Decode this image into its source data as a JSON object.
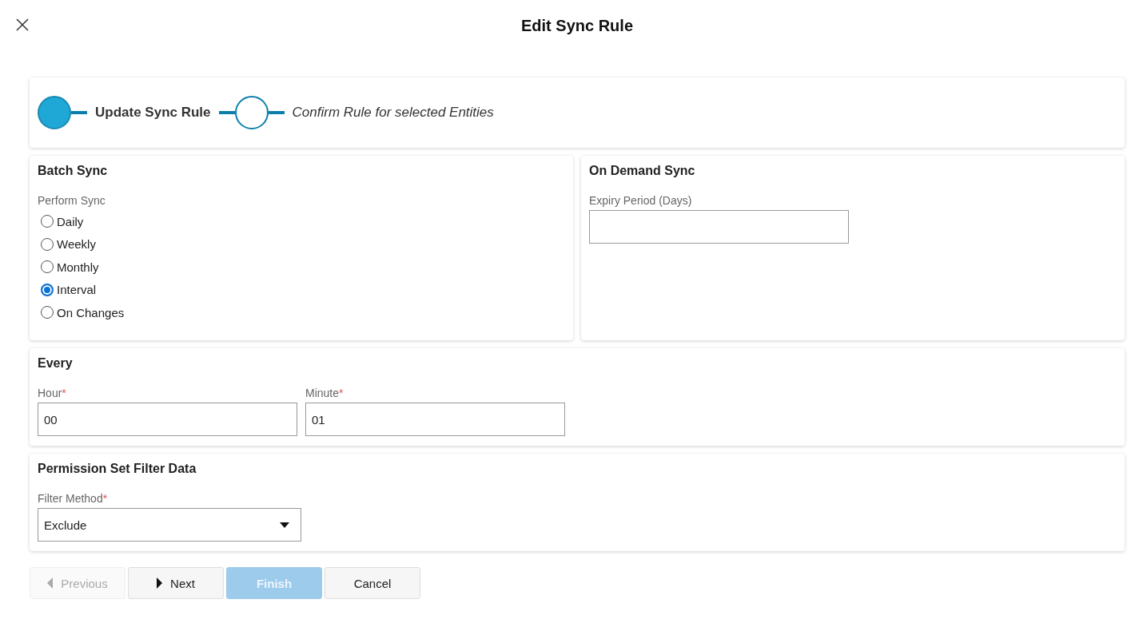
{
  "dialog": {
    "title": "Edit Sync Rule"
  },
  "steps": [
    {
      "label": "Update Sync Rule",
      "selected": true
    },
    {
      "label": "Confirm Rule for selected Entities",
      "selected": false
    }
  ],
  "batch_sync": {
    "title": "Batch Sync",
    "group_label": "Perform Sync",
    "options": [
      {
        "label": "Daily",
        "selected": false
      },
      {
        "label": "Weekly",
        "selected": false
      },
      {
        "label": "Monthly",
        "selected": false
      },
      {
        "label": "Interval",
        "selected": true
      },
      {
        "label": "On Changes",
        "selected": false
      }
    ]
  },
  "on_demand_sync": {
    "title": "On Demand Sync",
    "field": {
      "label": "Expiry Period (Days)"
    }
  },
  "every": {
    "title": "Every",
    "fields": [
      {
        "label": "Hour",
        "required_mark": "*",
        "value": "00"
      },
      {
        "label": "Minute",
        "required_mark": "*",
        "value": "01"
      }
    ]
  },
  "permission_filter": {
    "title": "Permission Set Filter Data",
    "field": {
      "label": "Filter Method",
      "required_mark": "*",
      "value": "Exclude"
    }
  },
  "buttons": [
    {
      "label": "Previous",
      "kind": "back",
      "disabled": true
    },
    {
      "label": "Next",
      "kind": "forward",
      "disabled": false
    },
    {
      "label": "Finish",
      "kind": "primary",
      "disabled": true
    },
    {
      "label": "Cancel",
      "kind": "plain",
      "disabled": false
    }
  ]
}
